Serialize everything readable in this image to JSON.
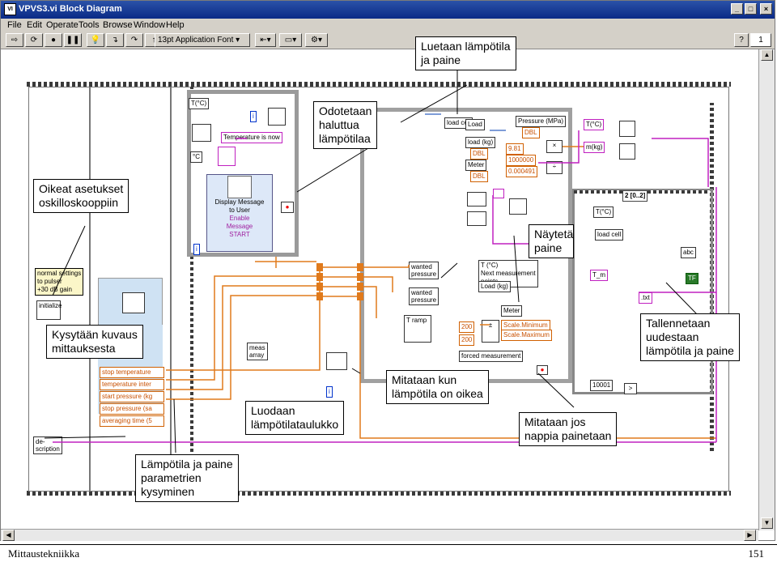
{
  "window": {
    "title": "VPVS3.vi Block Diagram",
    "icon_label": "VI",
    "minimize": "_",
    "maximize": "□",
    "close": "×"
  },
  "menu": [
    "File",
    "Edit",
    "Operate",
    "Tools",
    "Browse",
    "Window",
    "Help"
  ],
  "toolbar": {
    "font_selector": "13pt Application Font",
    "help": "?",
    "vi_number": "1"
  },
  "diagram": {
    "temp_const": "T(°C)",
    "celsius": "°C",
    "index": "i",
    "temperature_now": "Temperature is now",
    "display_message": [
      "Display Message",
      "to User"
    ],
    "menu_enable": "Enable",
    "menu_message": "Message",
    "menu_start": "START",
    "normal_settings": [
      "normal settings",
      "to pulser",
      "+30 dB gain"
    ],
    "initialize": "initialize",
    "params": [
      "stop temperature",
      "temperature inter",
      "start pressure (kg",
      "stop pressure (sa",
      "averaging time (5"
    ],
    "description": [
      "de-",
      "scription"
    ],
    "meas_array": [
      "meas",
      "array"
    ],
    "load_cell": "load cell",
    "load": "Load",
    "load_kg": "load (kg)",
    "meter": "Meter",
    "dbl": "DBL",
    "const_981": "9.81",
    "const_1000000": "1000000",
    "const_000491": "0.000491",
    "pressure_mpa": "Pressure (MPa)",
    "wanted_pressure": [
      "wanted",
      "pressure"
    ],
    "t_ramp": "T ramp",
    "next_measurement": [
      "T (°C)",
      "Next measurement",
      "points"
    ],
    "load_kg2": "Load (kg)",
    "meter2": "Meter",
    "const_200a": "200",
    "const_200b": "200",
    "scale_min": "Scale.Minimum",
    "scale_max": "Scale.Maximum",
    "forced_measurement": "forced measurement",
    "case_selector": "2 [0..2]",
    "t_m": "T_m",
    "txt": ".txt",
    "abc": "abc",
    "tf": "TF",
    "t_c": "T(°C)",
    "m_kg": "m(kg)",
    "const_10001": "10001"
  },
  "callouts": {
    "luetaan": [
      "Luetaan lämpötila",
      "ja paine"
    ],
    "odotetaan": [
      "Odotetaan",
      "haluttua",
      "lämpötilaa"
    ],
    "oikeat": [
      "Oikeat asetukset",
      "oskilloskooppiin"
    ],
    "naytetaan": [
      "Näytetä",
      "paine"
    ],
    "kysytaan": [
      "Kysytään kuvaus",
      "mittauksesta"
    ],
    "tallennetaan": [
      "Tallennetaan",
      "uudestaan",
      "lämpötila ja paine"
    ],
    "mitataan_kun": [
      "Mitataan kun",
      "lämpötila on oikea"
    ],
    "luodaan": [
      "Luodaan",
      "lämpötilataulukko"
    ],
    "mitataan_jos": [
      "Mitataan jos",
      "nappia painetaan"
    ],
    "lampotila": [
      "Lämpötila ja paine",
      "parametrien",
      "kysyminen"
    ]
  },
  "footer": {
    "left": "Mittaustekniikka",
    "right": "151"
  }
}
